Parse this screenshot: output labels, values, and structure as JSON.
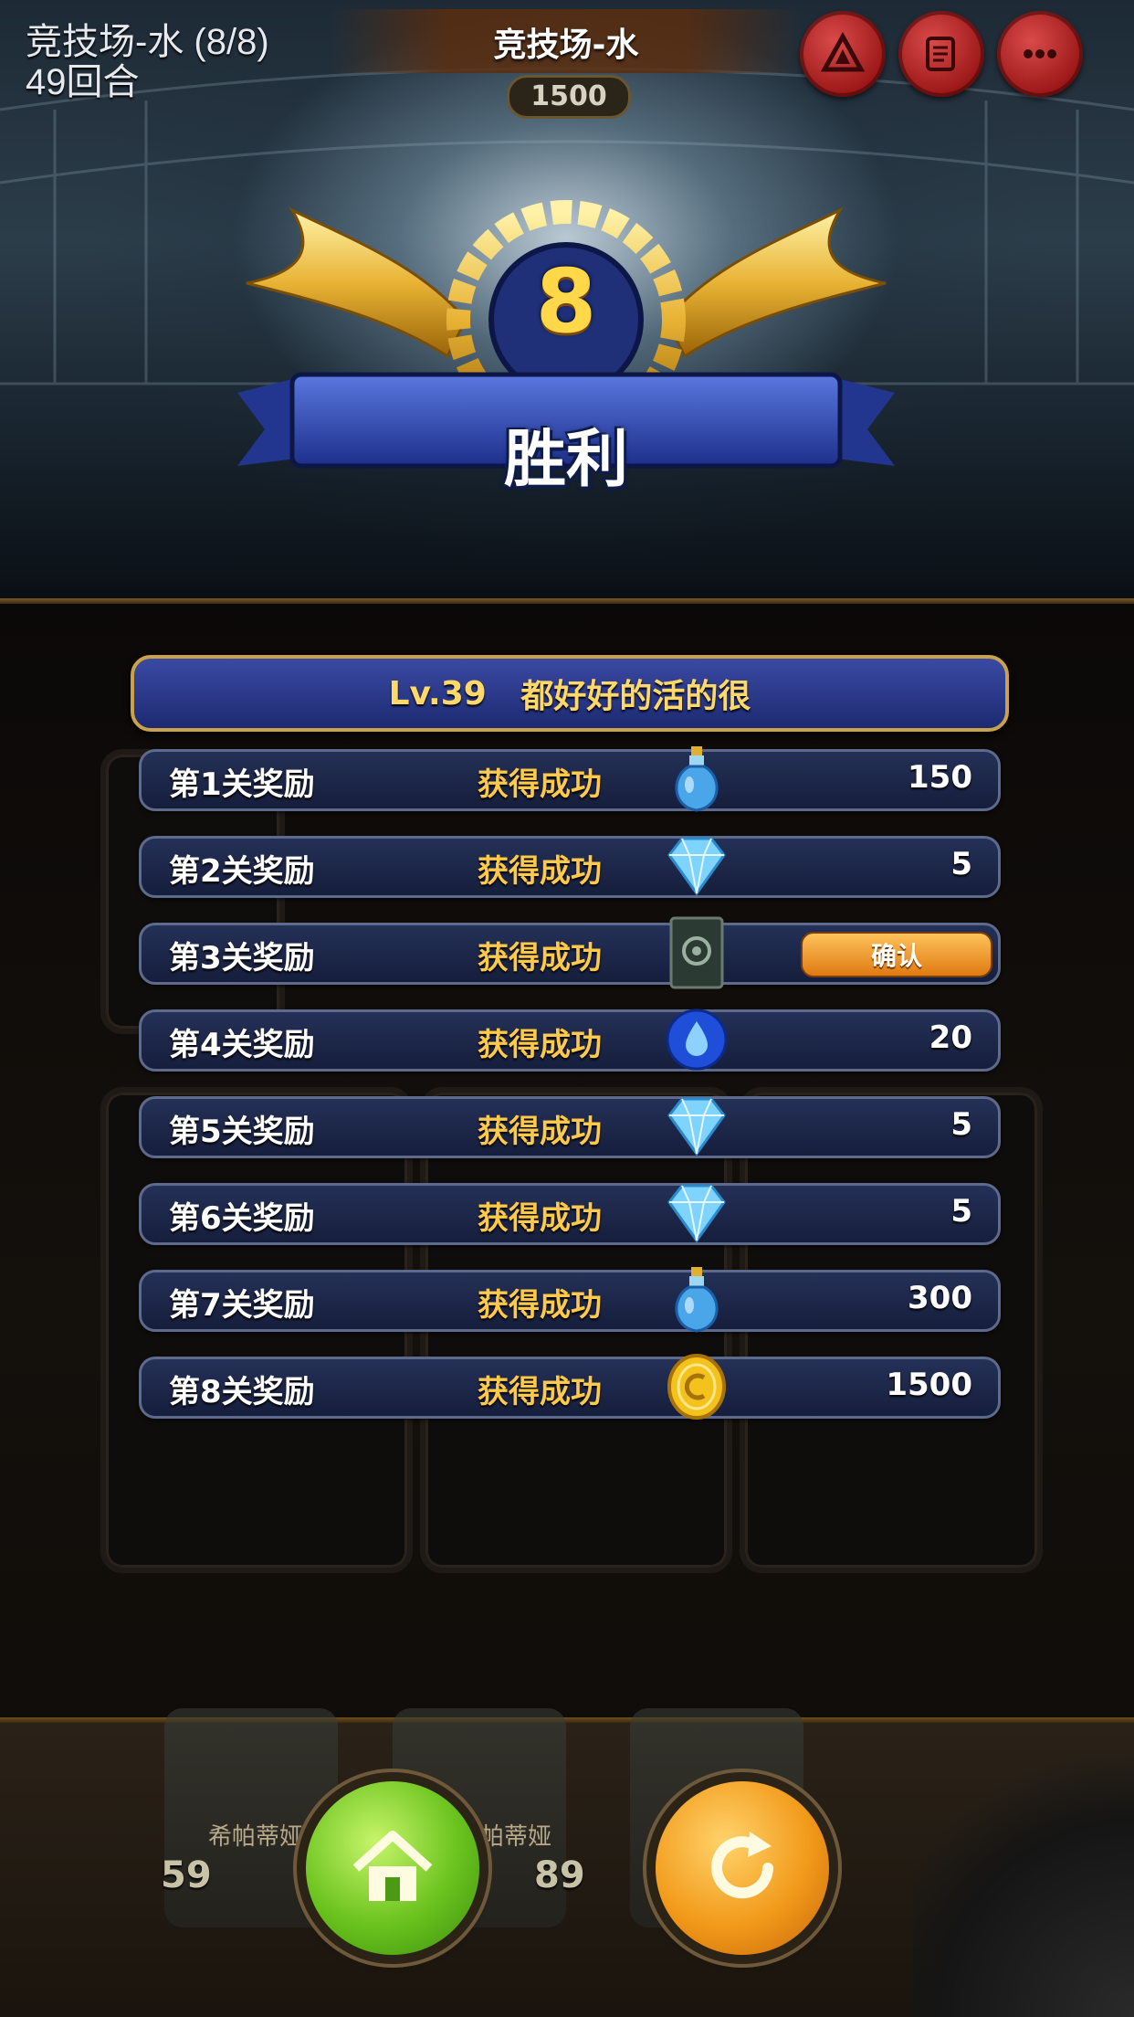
{
  "arena": {
    "name": "竞技场-水 (8/8)",
    "turns": "49回合"
  },
  "header": {
    "title": "竞技场-水",
    "score": "1500"
  },
  "top_buttons": [
    {
      "icon": "triangle-emblem-icon"
    },
    {
      "icon": "scroll-icon"
    },
    {
      "icon": "more-options-icon"
    }
  ],
  "result": {
    "rank": "8",
    "label": "胜利"
  },
  "player": {
    "level": "Lv.39",
    "name": "都好好的活的很"
  },
  "rewards": [
    {
      "stage": "第1关奖励",
      "status": "获得成功",
      "icon": "potion-icon",
      "amount": "150"
    },
    {
      "stage": "第2关奖励",
      "status": "获得成功",
      "icon": "diamond-icon",
      "amount": "5"
    },
    {
      "stage": "第3关奖励",
      "status": "获得成功",
      "icon": "card-item-icon",
      "action": "确认"
    },
    {
      "stage": "第4关奖励",
      "status": "获得成功",
      "icon": "water-orb-icon",
      "amount": "20"
    },
    {
      "stage": "第5关奖励",
      "status": "获得成功",
      "icon": "diamond-icon",
      "amount": "5"
    },
    {
      "stage": "第6关奖励",
      "status": "获得成功",
      "icon": "diamond-icon",
      "amount": "5"
    },
    {
      "stage": "第7关奖励",
      "status": "获得成功",
      "icon": "potion-icon",
      "amount": "300"
    },
    {
      "stage": "第8关奖励",
      "status": "获得成功",
      "icon": "gold-coin-icon",
      "amount": "1500"
    }
  ],
  "background_heroes": [
    {
      "name": "希帕蒂娅",
      "level": "59"
    },
    {
      "name": "希帕蒂娅",
      "level": "89"
    }
  ],
  "footer_buttons": [
    {
      "icon": "home-icon"
    },
    {
      "icon": "replay-icon"
    }
  ],
  "colors": {
    "accent_gold": "#ffc94a",
    "panel_blue": "#1d2a72",
    "home_green": "#69c21d",
    "replay_orange": "#f29a1a"
  }
}
